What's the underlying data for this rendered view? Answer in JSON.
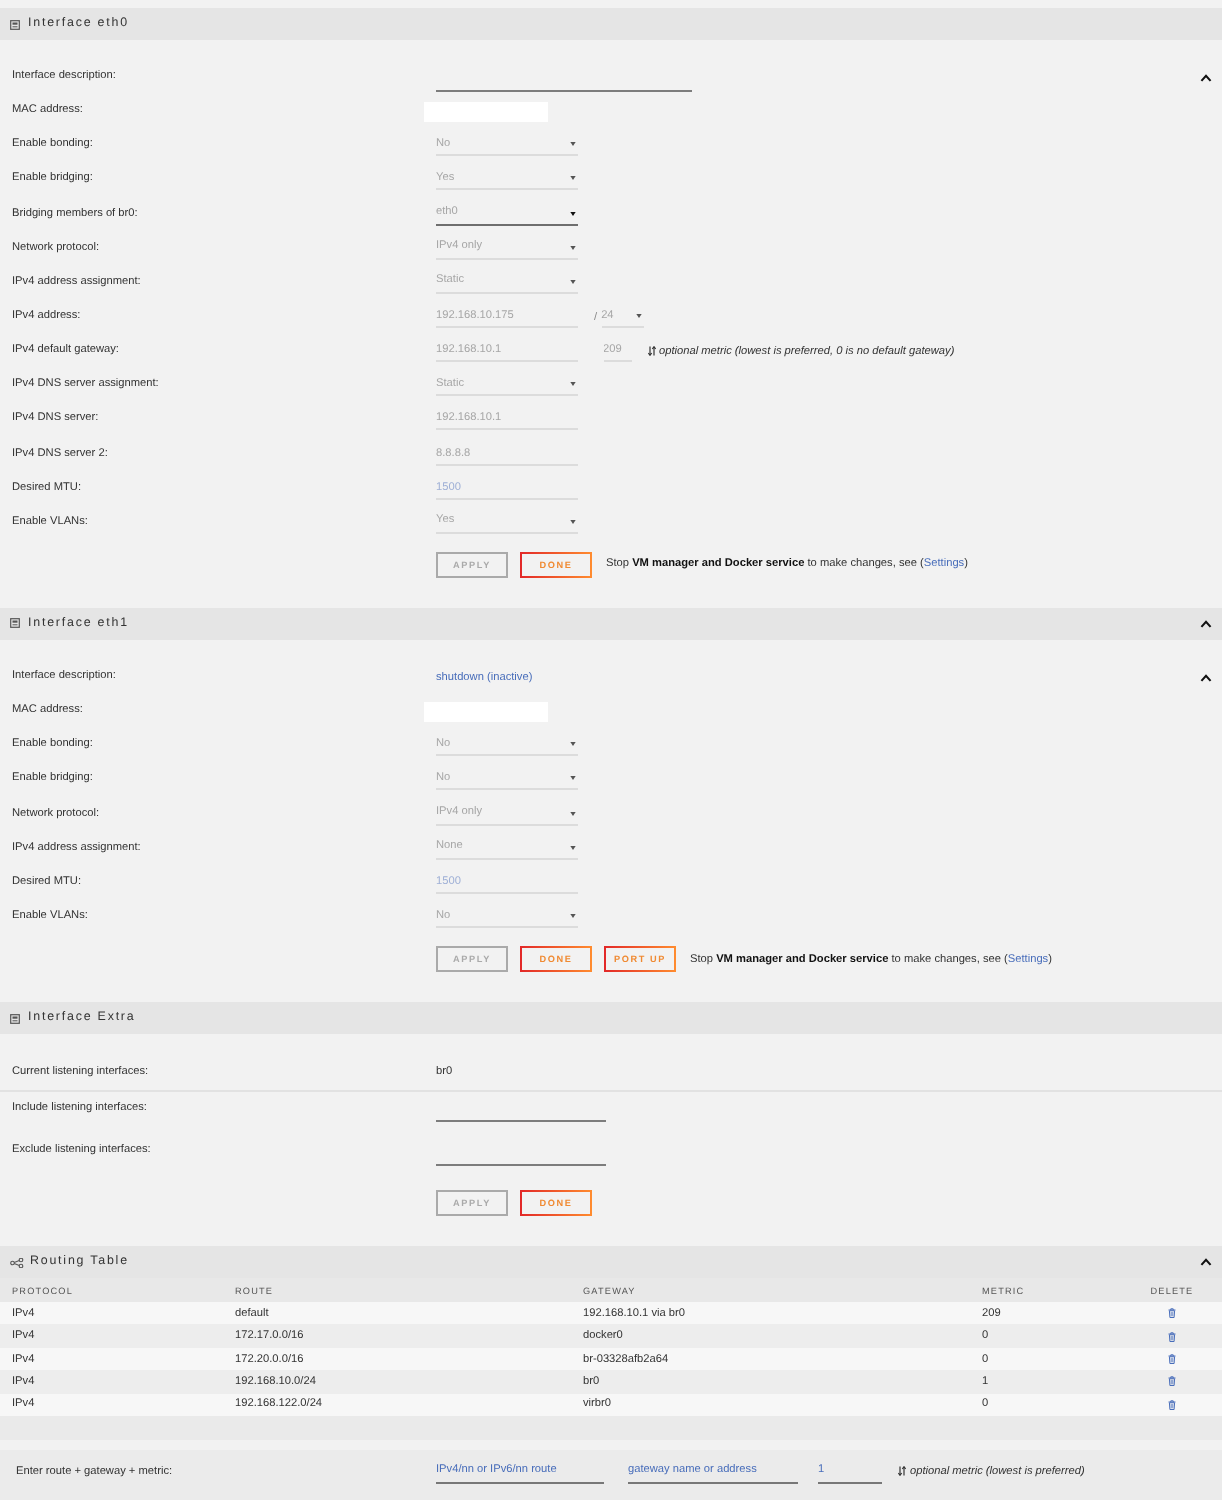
{
  "sections": [
    {
      "kind": "form",
      "title": "Interface eth0",
      "rows": [
        {
          "label": "Interface description:",
          "collapse_toggle": true,
          "field": {
            "kind": "long_text",
            "disabled": false
          }
        },
        {
          "label": "MAC address:",
          "field": {
            "kind": "mac"
          }
        },
        {
          "label": "Enable bonding:",
          "field": {
            "kind": "select",
            "value": "No",
            "disabled": true
          }
        },
        {
          "label": "Enable bridging:",
          "field": {
            "kind": "select",
            "value": "Yes",
            "disabled": true
          }
        },
        {
          "label": "Bridging members of br0:",
          "field": {
            "kind": "select",
            "value": "eth0",
            "disabled": false
          }
        },
        {
          "label": "Network protocol:",
          "field": {
            "kind": "select",
            "value": "IPv4 only",
            "disabled": true
          }
        },
        {
          "label": "IPv4 address assignment:",
          "field": {
            "kind": "select",
            "value": "Static",
            "disabled": true
          }
        },
        {
          "label": "IPv4 address:",
          "field": {
            "kind": "ip_prefix",
            "value": "192.168.10.175",
            "separator": "/",
            "prefix": "24",
            "disabled": true
          }
        },
        {
          "label": "IPv4 default gateway:",
          "field": {
            "kind": "gateway",
            "value": "192.168.10.1",
            "metric": "209",
            "note": "optional metric (lowest is preferred, 0 is no default gateway)",
            "disabled": true
          }
        },
        {
          "label": "IPv4 DNS server assignment:",
          "field": {
            "kind": "select",
            "value": "Static",
            "disabled": true
          }
        },
        {
          "label": "IPv4 DNS server:",
          "field": {
            "kind": "text",
            "value": "192.168.10.1",
            "disabled": true
          }
        },
        {
          "label": "IPv4 DNS server 2:",
          "field": {
            "kind": "text",
            "value": "8.8.8.8",
            "disabled": true
          }
        },
        {
          "label": "Desired MTU:",
          "field": {
            "kind": "text",
            "placeholder": "1500",
            "disabled": true
          }
        },
        {
          "label": "Enable VLANs:",
          "field": {
            "kind": "select",
            "value": "Yes",
            "disabled": true
          }
        }
      ],
      "buttons": [
        {
          "label": "APPLY",
          "disabled": true
        },
        {
          "label": "DONE",
          "disabled": false
        }
      ],
      "note": {
        "text": "Stop **VM manager and Docker service** to make changes, see (",
        "link": "Settings",
        "after": ")"
      }
    },
    {
      "kind": "form",
      "title": "Interface eth1",
      "collapse_toggle": true,
      "rows": [
        {
          "label": "Interface description:",
          "collapse_toggle": true,
          "field": {
            "kind": "link",
            "value": "shutdown (inactive)"
          }
        },
        {
          "label": "MAC address:",
          "field": {
            "kind": "mac"
          }
        },
        {
          "label": "Enable bonding:",
          "field": {
            "kind": "select",
            "value": "No",
            "disabled": true
          }
        },
        {
          "label": "Enable bridging:",
          "field": {
            "kind": "select",
            "value": "No",
            "disabled": true
          }
        },
        {
          "label": "Network protocol:",
          "field": {
            "kind": "select",
            "value": "IPv4 only",
            "disabled": true
          }
        },
        {
          "label": "IPv4 address assignment:",
          "field": {
            "kind": "select",
            "value": "None",
            "disabled": true
          }
        },
        {
          "label": "Desired MTU:",
          "field": {
            "kind": "text",
            "placeholder": "1500",
            "disabled": true
          }
        },
        {
          "label": "Enable VLANs:",
          "field": {
            "kind": "select",
            "value": "No",
            "disabled": true
          }
        }
      ],
      "buttons": [
        {
          "label": "APPLY",
          "disabled": true
        },
        {
          "label": "DONE",
          "disabled": false
        },
        {
          "label": "PORT UP",
          "disabled": false
        }
      ],
      "note": {
        "text": "Stop **VM manager and Docker service** to make changes, see (",
        "link": "Settings",
        "after": ")"
      }
    },
    {
      "kind": "form",
      "title": "Interface Extra",
      "rows": [
        {
          "label": "Current listening interfaces:",
          "field": {
            "kind": "static",
            "value": "br0"
          }
        },
        {
          "label": "Include listening interfaces:",
          "field": {
            "kind": "list",
            "disabled": false
          }
        },
        {
          "label": "Exclude listening interfaces:",
          "field": {
            "kind": "list",
            "disabled": false
          }
        }
      ],
      "buttons": [
        {
          "label": "APPLY",
          "disabled": true
        },
        {
          "label": "DONE",
          "disabled": false
        }
      ]
    },
    {
      "kind": "table",
      "title": "Routing Table",
      "collapse_toggle": true,
      "columns": [
        "PROTOCOL",
        "ROUTE",
        "GATEWAY",
        "METRIC",
        "DELETE"
      ],
      "rows": [
        {
          "protocol": "IPv4",
          "route": "default",
          "gateway": "192.168.10.1 via br0",
          "metric": "209"
        },
        {
          "protocol": "IPv4",
          "route": "172.17.0.0/16",
          "gateway": "docker0",
          "metric": "0"
        },
        {
          "protocol": "IPv4",
          "route": "172.20.0.0/16",
          "gateway": "br-03328afb2a64",
          "metric": "0"
        },
        {
          "protocol": "IPv4",
          "route": "192.168.10.0/24",
          "gateway": "br0",
          "metric": "1"
        },
        {
          "protocol": "IPv4",
          "route": "192.168.122.0/24",
          "gateway": "virbr0",
          "metric": "0"
        }
      ],
      "entry": {
        "label": "Enter route + gateway + metric:",
        "route_placeholder": "IPv4/nn or IPv6/nn route",
        "gateway_placeholder": "gateway name or address",
        "metric_placeholder": "1",
        "note": "optional metric (lowest is preferred)"
      }
    }
  ]
}
